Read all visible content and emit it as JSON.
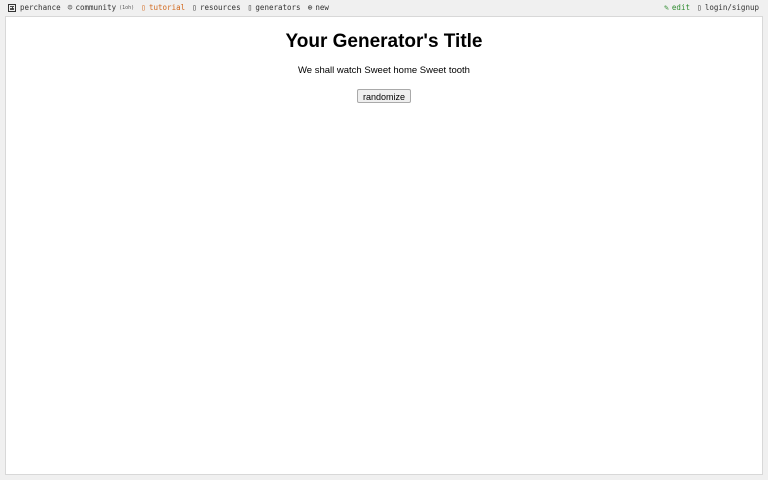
{
  "nav": {
    "brand": {
      "label": "perchance",
      "icon": "dice-icon"
    },
    "community": {
      "label": "community",
      "sub": "(1oh)",
      "icon": "people-icon",
      "icon_glyph": "☺"
    },
    "tutorial": {
      "label": "tutorial",
      "icon": "book-icon",
      "icon_glyph": "▯",
      "color": "#d2691e"
    },
    "resources": {
      "label": "resources",
      "icon": "resources-icon",
      "icon_glyph": "▯"
    },
    "generators": {
      "label": "generators",
      "icon": "generators-icon",
      "icon_glyph": "▯"
    },
    "new": {
      "label": "new",
      "icon": "plus-circle-icon",
      "icon_glyph": "⊕"
    },
    "edit": {
      "label": "edit",
      "icon": "pencil-icon",
      "icon_glyph": "✎",
      "color": "#2e8b2e"
    },
    "login": {
      "label": "login/signup",
      "icon": "user-icon",
      "icon_glyph": "▯"
    }
  },
  "generator": {
    "title": "Your Generator's Title",
    "output": "We shall watch Sweet home Sweet tooth",
    "randomize_label": "randomize"
  }
}
